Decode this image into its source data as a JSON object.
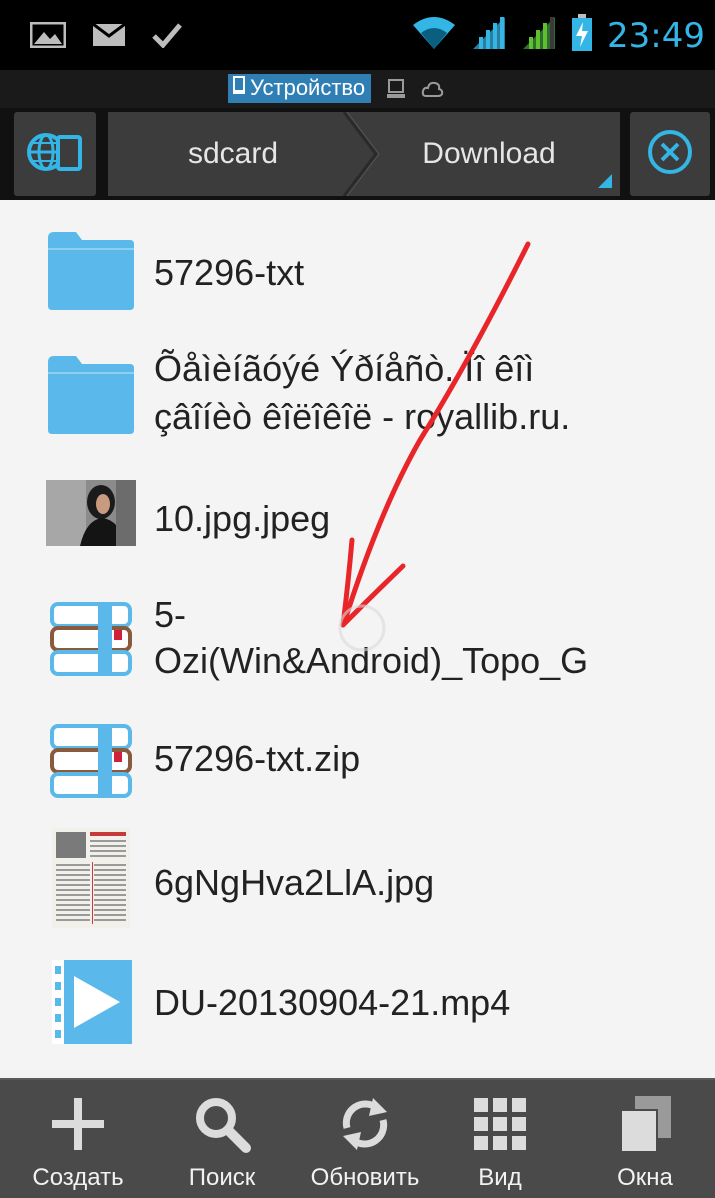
{
  "status_bar": {
    "time": "23:49",
    "left_icons": [
      "image-icon",
      "mail-icon",
      "check-icon"
    ],
    "right_icons": [
      "wifi-icon",
      "signal-icon",
      "signal-icon",
      "battery-charging-icon"
    ]
  },
  "location_bar": {
    "device_label": "Устройство",
    "icons": [
      "device-icon",
      "network-drive-icon",
      "cloud-icon"
    ]
  },
  "toolbar": {
    "breadcrumbs": [
      "sdcard",
      "Download"
    ],
    "left_icon": "globe-device-icon",
    "right_icon": "close-circle-icon"
  },
  "files": [
    {
      "name": "57296-txt",
      "type": "folder",
      "icon": "folder-icon"
    },
    {
      "name_lines": [
        "Õåìèíãóýé Ýðíåñò. Ïî êîì",
        "çâîíèò êîëîêîë - royallib.ru."
      ],
      "type": "folder",
      "icon": "folder-icon"
    },
    {
      "name": "10.jpg.jpeg",
      "type": "image",
      "icon": "photo-thumbnail-icon"
    },
    {
      "name_lines": [
        "5-",
        "Ozi(Win&Android)_Topo_G"
      ],
      "type": "archive",
      "icon": "archive-books-icon"
    },
    {
      "name": "57296-txt.zip",
      "type": "archive",
      "icon": "archive-books-icon"
    },
    {
      "name": "6gNgHva2LlA.jpg",
      "type": "image",
      "icon": "document-thumbnail-icon"
    },
    {
      "name": "DU-20130904-21.mp4",
      "type": "video",
      "icon": "video-play-icon"
    }
  ],
  "bottom_bar": {
    "items": [
      {
        "label": "Создать",
        "icon": "plus-icon"
      },
      {
        "label": "Поиск",
        "icon": "search-icon"
      },
      {
        "label": "Обновить",
        "icon": "refresh-icon"
      },
      {
        "label": "Вид",
        "icon": "grid-icon"
      },
      {
        "label": "Окна",
        "icon": "windows-icon"
      }
    ]
  },
  "colors": {
    "accent": "#33b5e5",
    "folder": "#5ab9ea",
    "annotation_arrow": "#e8262a",
    "bottom_bar": "#4a4a4a"
  }
}
